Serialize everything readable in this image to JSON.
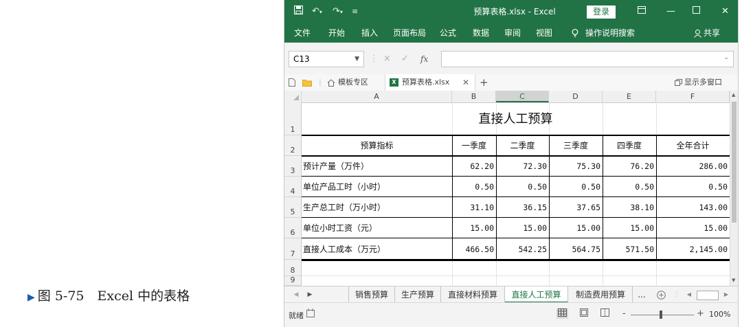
{
  "caption": "图 5-75　Excel 中的表格",
  "window": {
    "title": "预算表格.xlsx - Excel",
    "login_label": "登录",
    "qat": [
      "▣",
      "↶",
      "↷",
      "="
    ],
    "controls": [
      "▫",
      "—",
      "□",
      "✕"
    ]
  },
  "ribbon": {
    "tabs": [
      "文件",
      "开始",
      "插入",
      "页面布局",
      "公式",
      "数据",
      "审阅",
      "视图"
    ],
    "search_label": "操作说明搜索",
    "share_label": "共享"
  },
  "formula_bar": {
    "name_box": "C13",
    "cancel_glyph": "×",
    "enter_glyph": "✓",
    "fx_label": "fx",
    "value": ""
  },
  "workbook_tabs": {
    "template_label": "模板专区",
    "doc_label": "预算表格.xlsx",
    "add_label": "+",
    "multiwin_label": "显示多窗口"
  },
  "grid": {
    "columns": [
      "A",
      "B",
      "C",
      "D",
      "E",
      "F"
    ],
    "selected_column": "C",
    "row_numbers": [
      "1",
      "2",
      "3",
      "4",
      "5",
      "6",
      "7",
      "8",
      "9"
    ]
  },
  "table": {
    "title": "直接人工预算",
    "headers": [
      "预算指标",
      "一季度",
      "二季度",
      "三季度",
      "四季度",
      "全年合计"
    ],
    "rows": [
      [
        "预计产量（万件）",
        "62.20",
        "72.30",
        "75.30",
        "76.20",
        "286.00"
      ],
      [
        "单位产品工时（小时）",
        "0.50",
        "0.50",
        "0.50",
        "0.50",
        "0.50"
      ],
      [
        "生产总工时（万小时）",
        "31.10",
        "36.15",
        "37.65",
        "38.10",
        "143.00"
      ],
      [
        "单位小时工资（元）",
        "15.00",
        "15.00",
        "15.00",
        "15.00",
        "15.00"
      ],
      [
        "直接人工成本（万元）",
        "466.50",
        "542.25",
        "564.75",
        "571.50",
        "2,145.00"
      ]
    ]
  },
  "sheet_tabs": {
    "tabs": [
      "销售预算",
      "生产预算",
      "直接材料预算",
      "直接人工预算",
      "制造费用预算"
    ],
    "active": "直接人工预算",
    "more_label": "...",
    "add_sheet_label": "+"
  },
  "status_bar": {
    "ready_label": "就绪",
    "zoom_label": "100%",
    "zoom_minus": "-",
    "zoom_plus": "+"
  }
}
